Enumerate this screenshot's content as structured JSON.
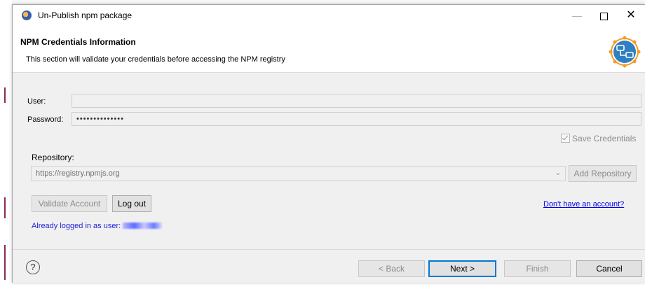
{
  "window": {
    "title": "Un-Publish npm package",
    "minimize_glyph": "—",
    "close_glyph": "✕"
  },
  "banner": {
    "heading": "NPM Credentials Information",
    "description": "This section will validate your credentials before accessing the NPM registry",
    "icon": "npm-wizard-icon"
  },
  "form": {
    "user_label": "User:",
    "user_value": "",
    "password_label": "Password:",
    "password_value": "••••••••••••••",
    "save_credentials_label": "Save Credentials",
    "save_credentials_checked": true,
    "repository_label": "Repository:",
    "repository_value": "https://registry.npmjs.org",
    "add_repository_label": "Add Repository"
  },
  "account": {
    "validate_label": "Validate Account",
    "logout_label": "Log out",
    "signup_link": "Don't have an account?",
    "status_text": "Already logged in as user:"
  },
  "footer": {
    "help_glyph": "?",
    "back_label": "< Back",
    "next_label": "Next >",
    "finish_label": "Finish",
    "cancel_label": "Cancel"
  },
  "colors": {
    "accent": "#0078d7",
    "link": "#0000ee",
    "status": "#1e1ed8"
  }
}
